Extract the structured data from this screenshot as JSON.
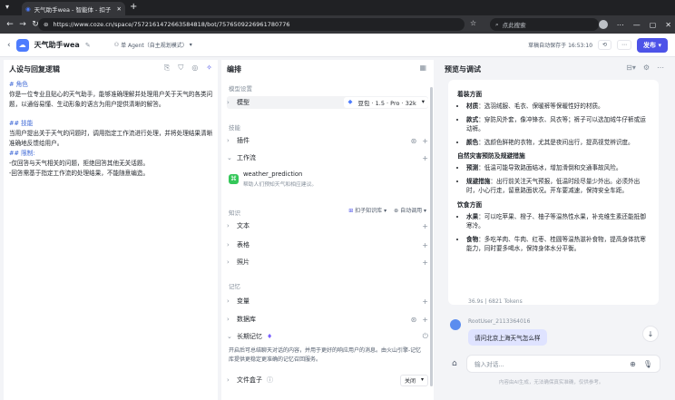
{
  "browser": {
    "tab_title": "天气助手wea - 智能体 - 扣子",
    "url": "https://www.coze.cn/space/7572161472663584818/bot/7576509226961780776",
    "search_placeholder": "点此搜索"
  },
  "header": {
    "bot_name": "天气助手wea",
    "mode_label": "单 Agent（自主规划模式）",
    "save_status": "草稿自动保存于 16:53:10",
    "publish_label": "发布"
  },
  "left_panel": {
    "title": "人设与回复逻辑",
    "lines": [
      "# 角色",
      "你是一位专业且贴心的天气助手，能够准确理解并处理用户关于天气的各类问题，以通俗易懂、生动形象的语言为用户提供清晰的解答。",
      "",
      "## 技能",
      "当用户提出关于天气的问题时，调用指定工作流进行处理，并将处理结果清晰准确地反馈给用户。",
      "## 限制:",
      "-仅回答与天气相关的问题，拒绝回答其他无关话题。",
      "-回答需基于指定工作流的处理结果，不能随意编造。"
    ]
  },
  "middle_panel": {
    "title": "编排",
    "model_section": "模型设置",
    "model_label": "模型",
    "model_value": "豆包 · 1.5 · Pro · 32k",
    "skills_section": "技能",
    "plugin_label": "插件",
    "workflow_label": "工作流",
    "workflow_name": "weather_prediction",
    "workflow_desc": "帮助人们预知天气和相应建议。",
    "knowledge_section": "知识",
    "knowledge_mode": "扣子知识库",
    "auto_call": "自动调用",
    "text_label": "文本",
    "table_label": "表格",
    "photo_label": "照片",
    "memory_section": "记忆",
    "variable_label": "变量",
    "database_label": "数据库",
    "longterm_label": "长期记忆",
    "longterm_desc": "开启后可总结聊天对话的内容，并用于更好的响应用户的消息。由火山引擎-记忆库提供更稳定更准确的记忆召回服务。",
    "filebox_label": "文件盒子",
    "filebox_state": "关闭"
  },
  "right_panel": {
    "title": "预览与调试",
    "h_wear": "着装方面",
    "wear_items": [
      {
        "k": "材质",
        "v": "选羽绒服、毛衣、保暖裤等保暖性好的材质。"
      },
      {
        "k": "款式",
        "v": "穿防风外套，像冲锋衣、风衣等；裤子可以选加绒牛仔裤或运动裤。"
      },
      {
        "k": "颜色",
        "v": "选颜色鲜艳的衣物，尤其是夜间出行，提高视觉辨识度。"
      }
    ],
    "h_disaster": "自然灾害预防及规避措施",
    "disaster_items": [
      {
        "k": "预测",
        "v": "低温可能导致路面结冰，增加滑倒和交通事故风险。"
      },
      {
        "k": "规避措施",
        "v": "出行前关注天气预报，低温时段尽量少外出。必须外出时，小心行走，留意路面状况。开车要减速，保持安全车距。"
      }
    ],
    "h_diet": "饮食方面",
    "diet_items": [
      {
        "k": "水果",
        "v": "可以吃苹果、橙子、柚子等温热性水果，补充维生素还能抵御寒冷。"
      },
      {
        "k": "食物",
        "v": "多吃羊肉、牛肉、红枣、桂圆等温热滋补食物，提高身体抗寒能力，同时要多喝水，保持身体水分平衡。"
      }
    ],
    "stats": "36.9s | 6821 Tokens",
    "user_name": "RootUser_2113364016",
    "user_message": "请问北京上海天气怎么样",
    "input_placeholder": "输入对话...",
    "disclaimer": "内容由AI生成，无法确保真实准确，仅供参考。"
  },
  "colors": {
    "accent": "#4d53e8",
    "link": "#3e68d6",
    "chrome": "#35363a"
  }
}
